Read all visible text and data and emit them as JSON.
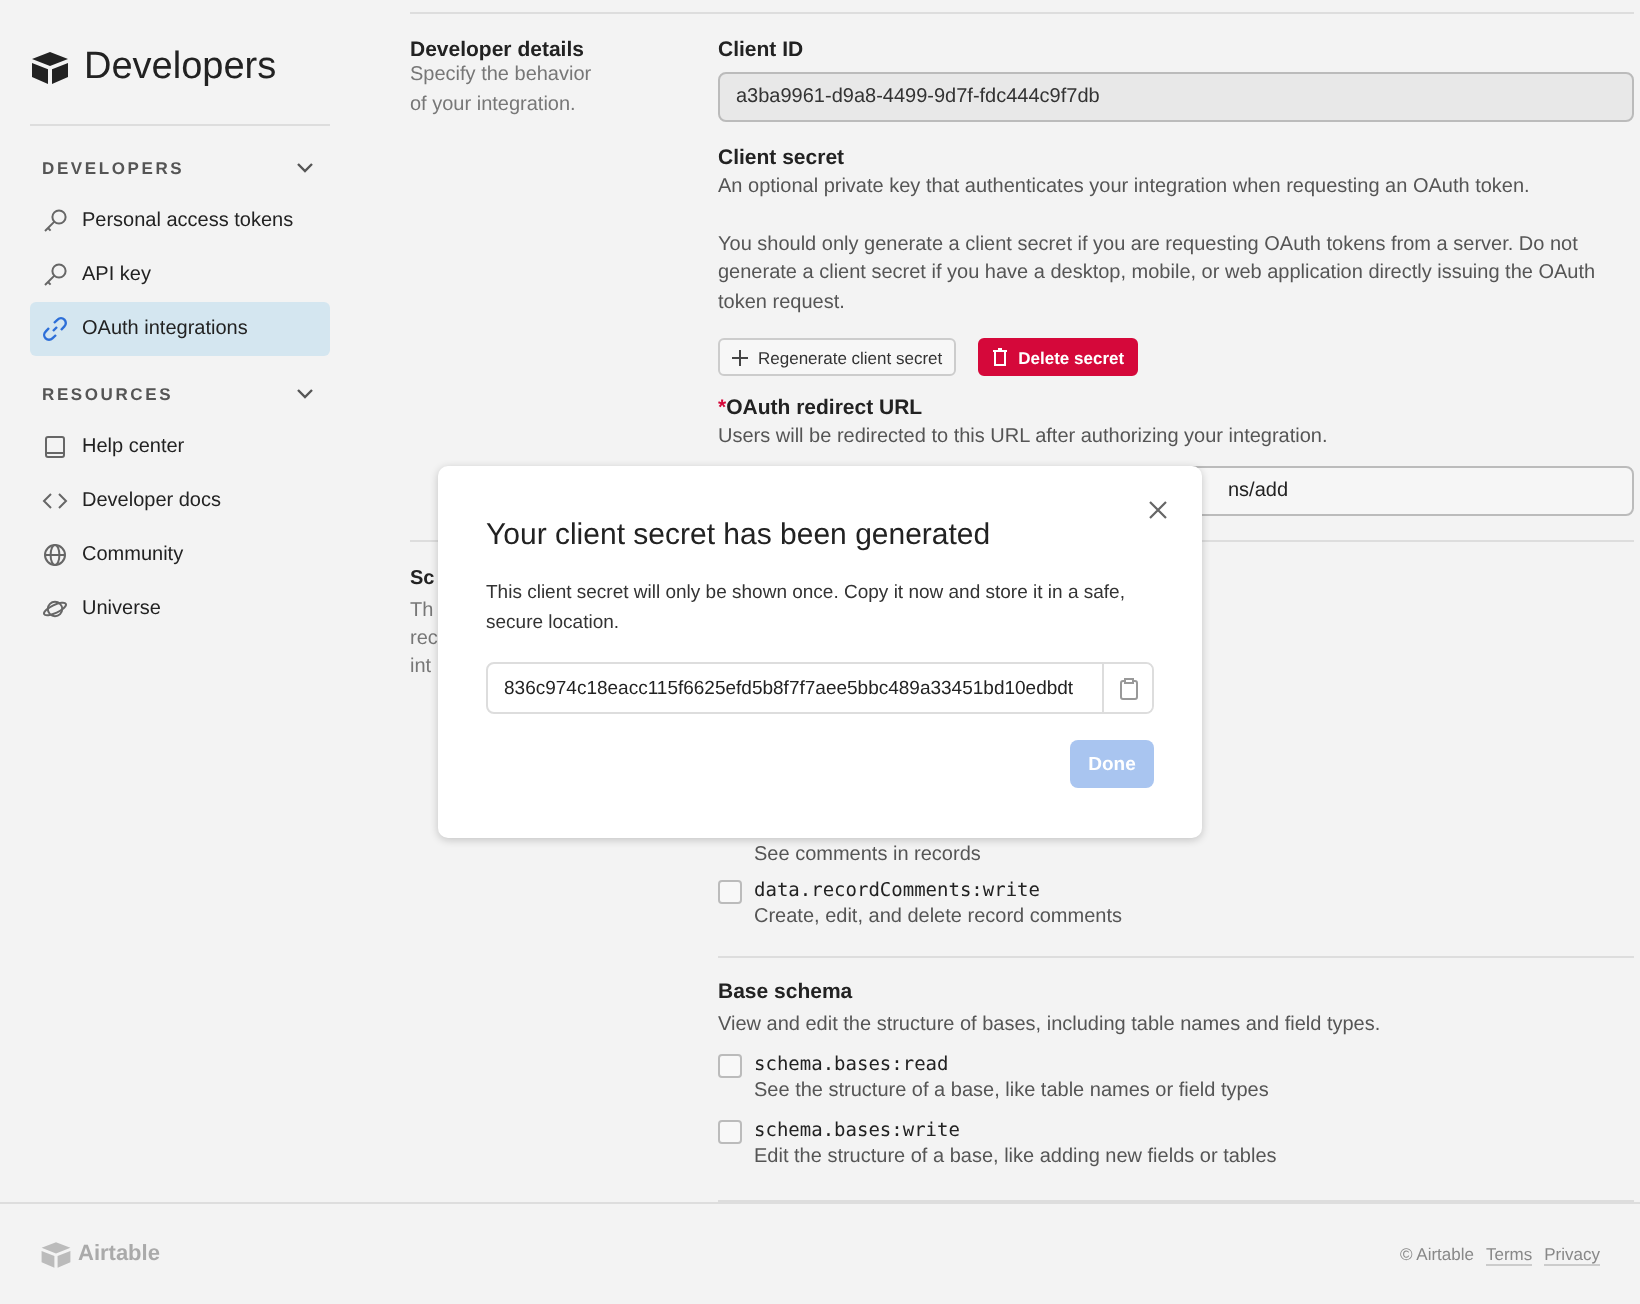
{
  "sidebar": {
    "title": "Developers",
    "sections": [
      {
        "heading": "DEVELOPERS",
        "expanded": true,
        "items": [
          {
            "label": "Personal access tokens",
            "kind": "key",
            "selected": false
          },
          {
            "label": "API key",
            "kind": "key",
            "selected": false
          },
          {
            "label": "OAuth integrations",
            "kind": "link",
            "selected": true
          }
        ]
      },
      {
        "heading": "RESOURCES",
        "expanded": true,
        "items": [
          {
            "label": "Help center",
            "kind": "book",
            "selected": false
          },
          {
            "label": "Developer docs",
            "kind": "code",
            "selected": false
          },
          {
            "label": "Community",
            "kind": "globe",
            "selected": false
          },
          {
            "label": "Universe",
            "kind": "planet",
            "selected": false
          }
        ]
      }
    ]
  },
  "details": {
    "title": "Developer details",
    "description": "Specify the behavior of your integration.",
    "client_id": {
      "label": "Client ID",
      "value": "a3ba9961-d9a8-4499-9d7f-fdc444c9f7db"
    },
    "client_secret": {
      "label": "Client secret",
      "description": "An optional private key that authenticates your integration when requesting an OAuth token.",
      "note": "You should only generate a client secret if you are requesting OAuth tokens from a server. Do not generate a client secret if you have a desktop, mobile, or web application directly issuing the OAuth token request.",
      "buttons": [
        {
          "label": "Regenerate client secret",
          "kind": "secondary"
        },
        {
          "label": "Delete secret",
          "kind": "danger"
        }
      ]
    },
    "redirect": {
      "label": "OAuth redirect URL",
      "required_mark": "*",
      "description": "Users will be redirected to this URL after authorizing your integration.",
      "value": "ns/add"
    }
  },
  "scopes": {
    "left_fragments": [
      "Sc",
      "Th",
      "rec",
      "int"
    ],
    "items": [
      {
        "kind": "note",
        "text": "See comments in records"
      },
      {
        "kind": "scope",
        "name": "data.recordComments:write",
        "description": "Create, edit, and delete record comments",
        "checked": false
      }
    ],
    "groups": [
      {
        "title": "Base schema",
        "description": "View and edit the structure of bases, including table names and field types.",
        "items": [
          {
            "kind": "scope",
            "name": "schema.bases:read",
            "description": "See the structure of a base, like table names or field types",
            "checked": false
          },
          {
            "kind": "scope",
            "name": "schema.bases:write",
            "description": "Edit the structure of a base, like adding new fields or tables",
            "checked": false
          }
        ]
      }
    ]
  },
  "modal": {
    "title": "Your client secret has been generated",
    "message": "This client secret will only be shown once. Copy it now and store it in a safe, secure location.",
    "secret": "836c974c18eacc115f6625efd5b8f7f7aee5bbc489a33451bd10edbdt",
    "done": {
      "label": "Done",
      "disabled": true
    }
  },
  "footer": {
    "brand": "Airtable",
    "copyright": "© Airtable",
    "links": [
      "Terms",
      "Privacy"
    ]
  }
}
